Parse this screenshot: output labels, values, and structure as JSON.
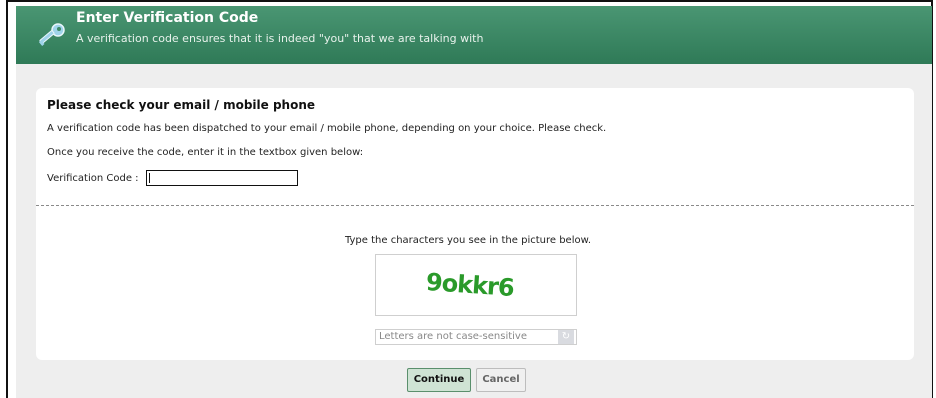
{
  "header": {
    "title": "Enter Verification Code",
    "subtitle": "A verification code ensures that it is indeed \"you\" that we are talking with",
    "icon": "key-icon",
    "color": "#3d8a66"
  },
  "main": {
    "section_title": "Please check your email / mobile phone",
    "line1": "A verification code has been dispatched to your email / mobile phone, depending on your choice. Please check.",
    "line2": "Once you receive the code, enter it in the textbox given below:",
    "code_label": "Verification Code :",
    "code_value": ""
  },
  "captcha": {
    "prompt": "Type the characters you see in the picture below.",
    "image_text": "9okkr6",
    "input_placeholder": "Letters are not case-sensitive",
    "refresh_icon": "refresh-icon"
  },
  "buttons": {
    "continue": "Continue",
    "cancel": "Cancel"
  }
}
